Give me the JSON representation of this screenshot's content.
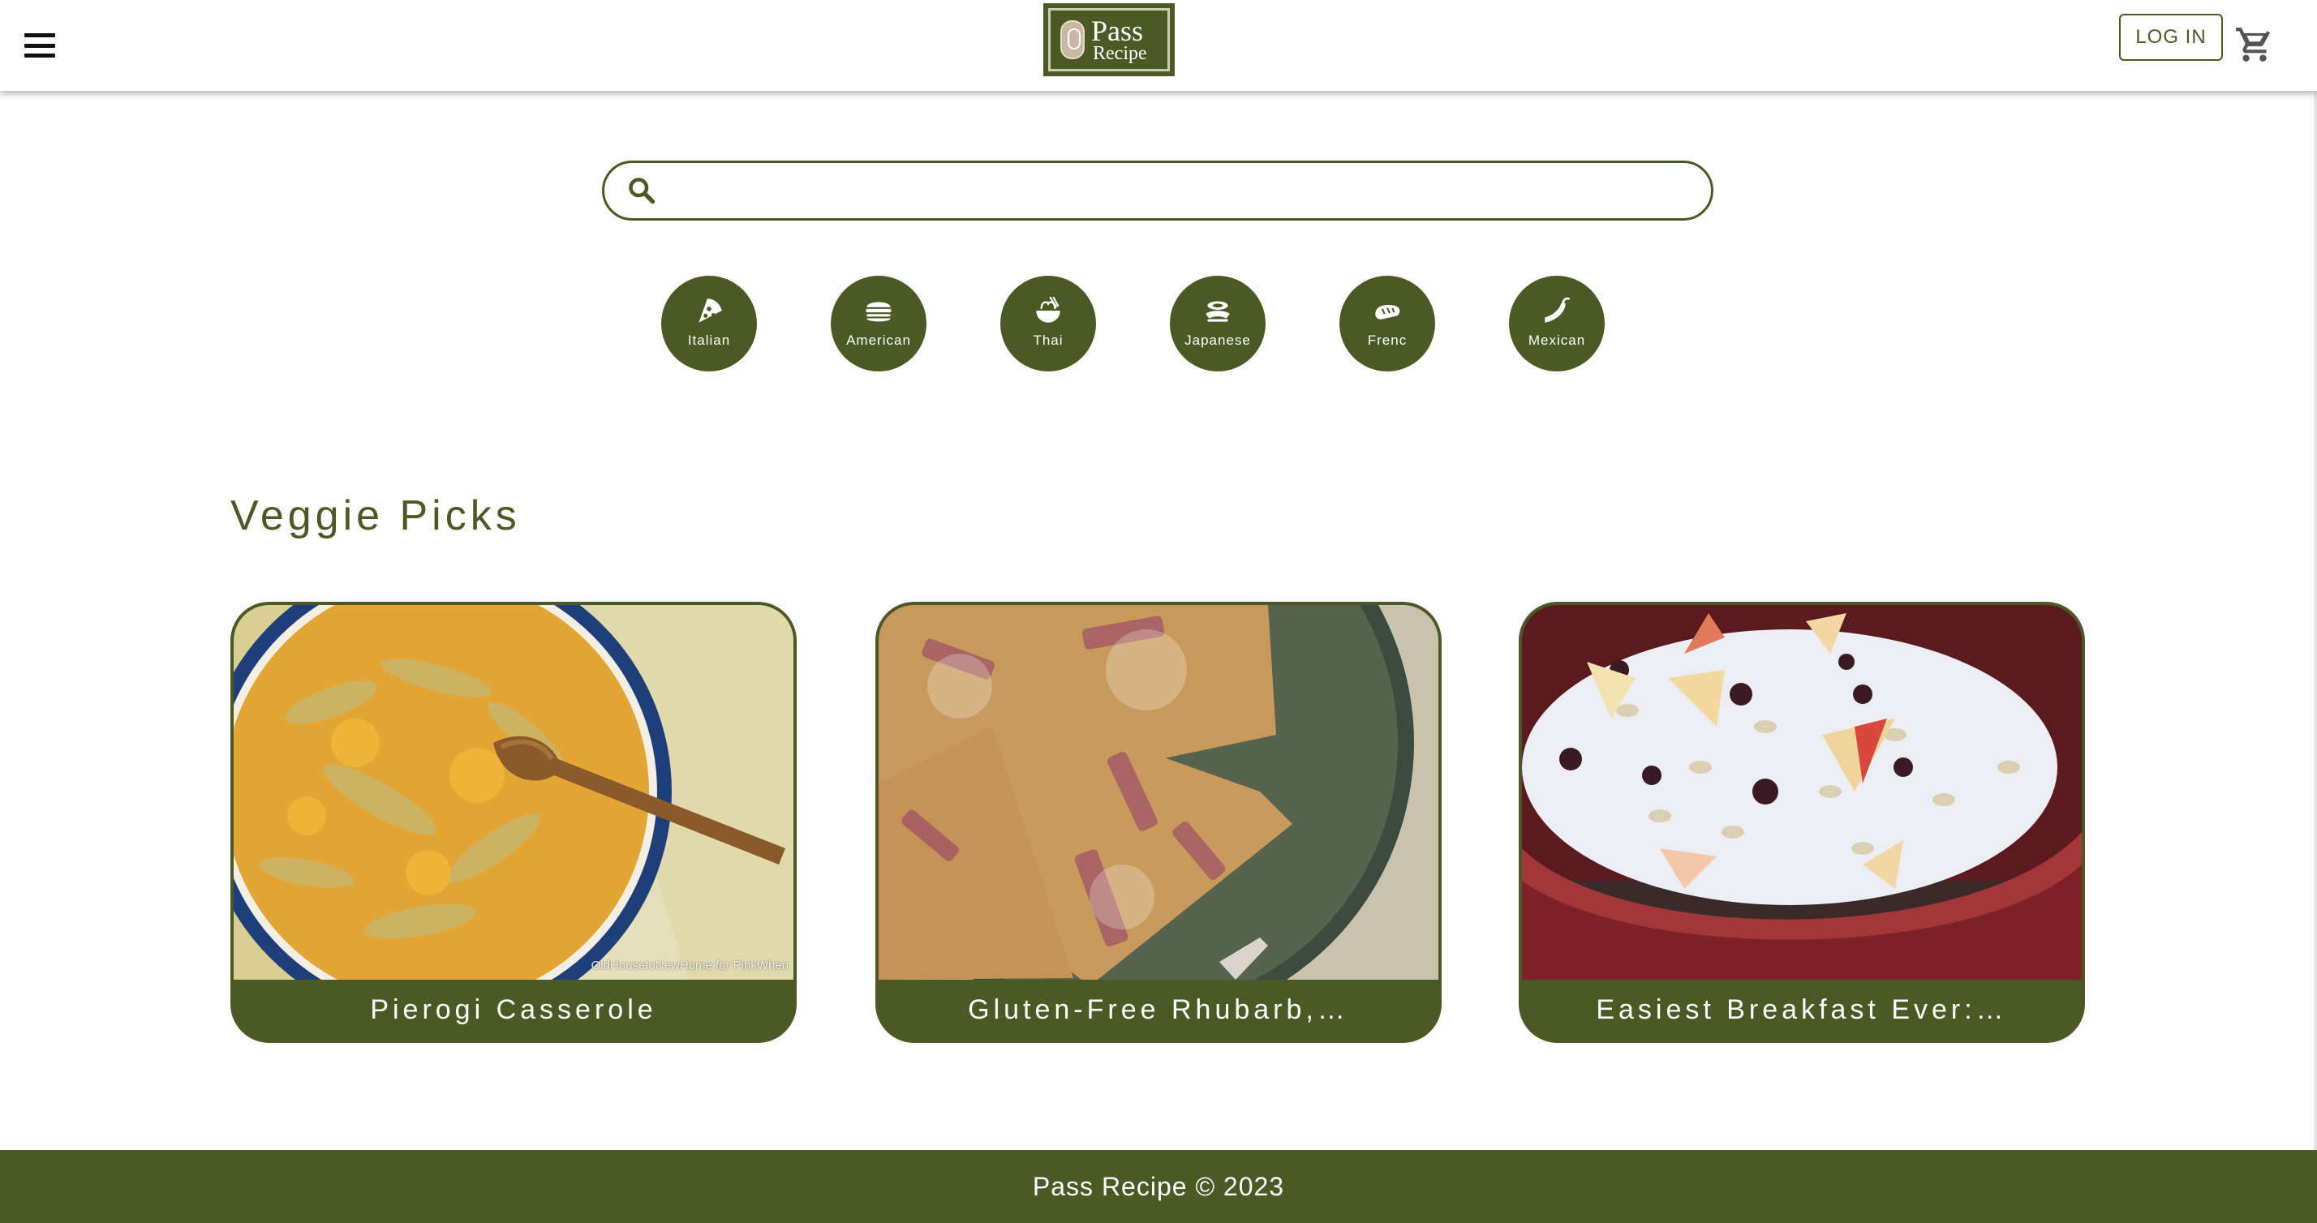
{
  "header": {
    "logo_line1": "Pass",
    "logo_line2": "Recipe",
    "login_label": "LOG IN",
    "menu_icon": "hamburger-menu-icon",
    "cart_icon": "shopping-cart-icon"
  },
  "search": {
    "icon": "search-icon",
    "value": "",
    "placeholder": ""
  },
  "categories": [
    {
      "label": "Italian",
      "icon": "pizza-icon"
    },
    {
      "label": "American",
      "icon": "burger-icon"
    },
    {
      "label": "Thai",
      "icon": "noodle-bowl-icon"
    },
    {
      "label": "Japanese",
      "icon": "sushi-icon"
    },
    {
      "label": "Frenc",
      "icon": "baguette-icon"
    },
    {
      "label": "Mexican",
      "icon": "chili-pepper-icon"
    }
  ],
  "section": {
    "title": "Veggie Picks"
  },
  "cards": [
    {
      "title": "Pierogi Casserole",
      "watermark": "OldHousetoNewHome for PinkWhen"
    },
    {
      "title": "Gluten-Free Rhubarb,…"
    },
    {
      "title": "Easiest Breakfast Ever:…"
    }
  ],
  "footer": {
    "text": "Pass Recipe © 2023"
  },
  "colors": {
    "brand_green": "#4b5a25",
    "white": "#ffffff"
  }
}
